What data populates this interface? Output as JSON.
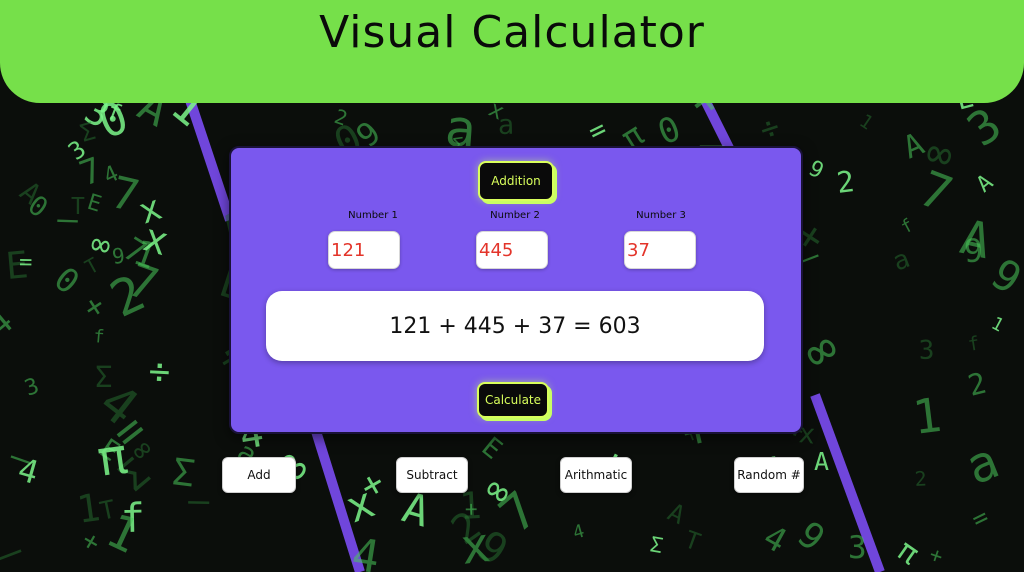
{
  "header": {
    "title": "Visual Calculator"
  },
  "calculator": {
    "mode_button_label": "Addition",
    "inputs": [
      {
        "label": "Number 1",
        "value": "121"
      },
      {
        "label": "Number 2",
        "value": "445"
      },
      {
        "label": "Number 3",
        "value": "37"
      }
    ],
    "result_text": "121 + 445 + 37 = 603",
    "calculate_label": "Calculate"
  },
  "operations": {
    "add_label": "Add",
    "subtract_label": "Subtract",
    "arithmatic_label": "Arithmatic",
    "random_label": "Random #"
  },
  "colors": {
    "header_bg": "#76e04a",
    "panel_bg": "#7a58ee",
    "accent_lime": "#d9ff5c",
    "input_text": "#e3342a",
    "background_glyphs": "#49c95a"
  },
  "background": {
    "description_icon": "matrix-math-background"
  }
}
